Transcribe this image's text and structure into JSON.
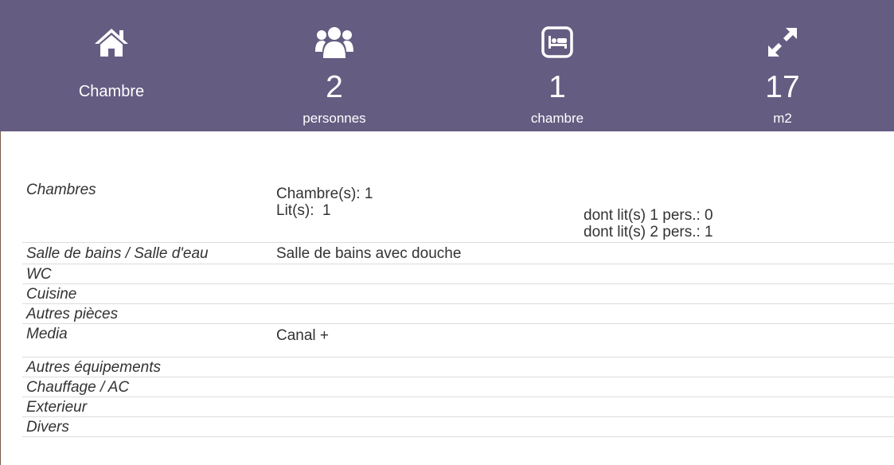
{
  "header": {
    "type_label": "Chambre",
    "persons": {
      "value": "2",
      "unit": "personnes"
    },
    "bedrooms": {
      "value": "1",
      "unit": "chambre"
    },
    "area": {
      "value": "17",
      "unit": "m2"
    }
  },
  "rows": {
    "chambres": {
      "label": "Chambres",
      "line1": "Chambre(s): 1",
      "line2": "Lit(s):  1",
      "detail1": "dont lit(s) 1 pers.: 0",
      "detail2": "dont lit(s) 2 pers.: 1"
    },
    "salle_de_bains": {
      "label": "Salle de bains / Salle d'eau",
      "value": "Salle de bains avec douche"
    },
    "wc": {
      "label": "WC"
    },
    "cuisine": {
      "label": "Cuisine"
    },
    "autres_pieces": {
      "label": "Autres pièces"
    },
    "media": {
      "label": "Media",
      "value": "Canal +"
    },
    "autres_equipements": {
      "label": "Autres équipements"
    },
    "chauffage": {
      "label": "Chauffage / AC"
    },
    "exterieur": {
      "label": "Exterieur"
    },
    "divers": {
      "label": "Divers"
    }
  },
  "icons": {
    "house": "home-icon",
    "users": "users-icon",
    "bed": "bed-icon",
    "expand": "expand-icon"
  },
  "colors": {
    "header_bg": "#655c82",
    "header_text": "#ffffff"
  }
}
